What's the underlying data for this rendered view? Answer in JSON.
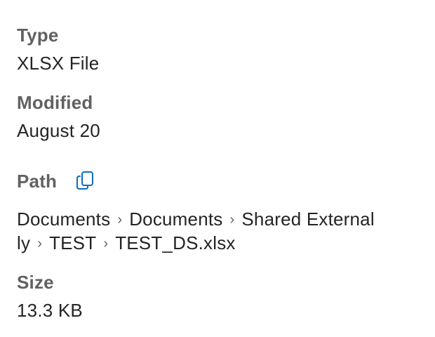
{
  "details": {
    "type": {
      "label": "Type",
      "value": "XLSX File"
    },
    "modified": {
      "label": "Modified",
      "value": "August 20"
    },
    "path": {
      "label": "Path",
      "copy_icon": "copy-icon",
      "separator": "›",
      "crumbs": [
        "Documents",
        "Documents",
        "Shared External",
        "ly",
        "TEST",
        "TEST_DS.xlsx"
      ]
    },
    "size": {
      "label": "Size",
      "value": "13.3 KB"
    }
  },
  "colors": {
    "label": "#616161",
    "value": "#242424",
    "accent": "#0f6cbd"
  }
}
